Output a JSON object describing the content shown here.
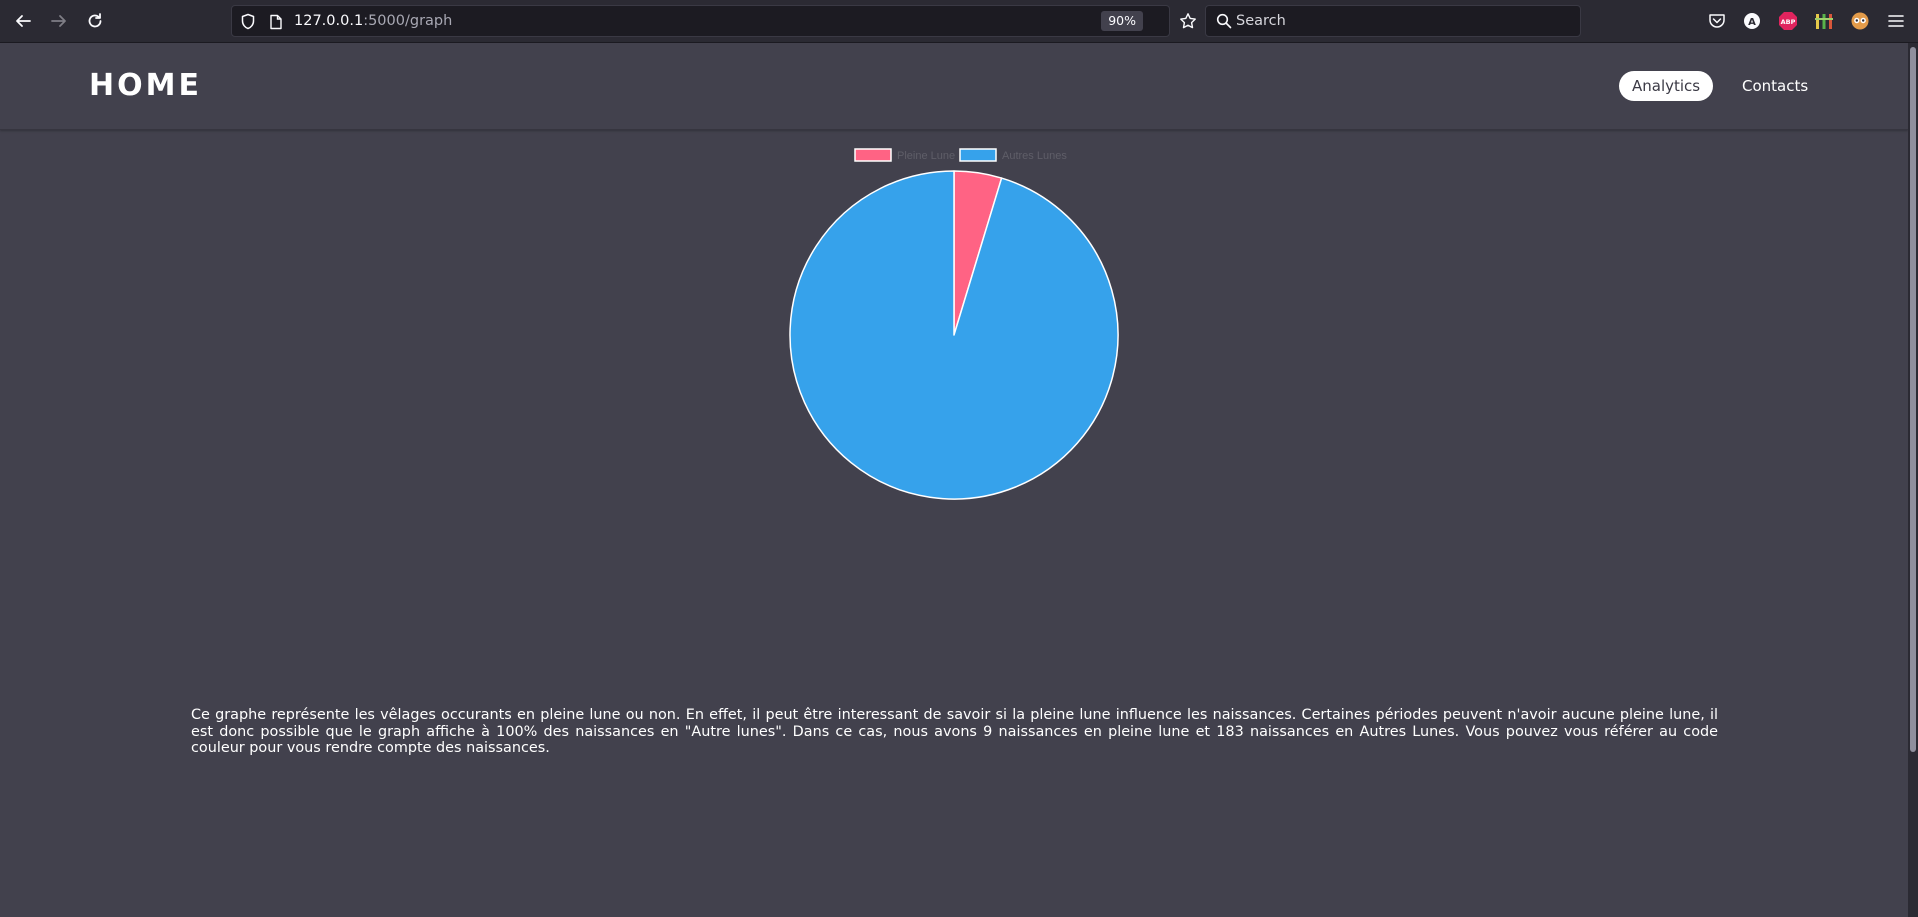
{
  "browser": {
    "url_host": "127.0.0.1",
    "url_path": ":5000/graph",
    "zoom": "90%",
    "search_placeholder": "Search",
    "icons": [
      "back-icon",
      "forward-icon",
      "reload-icon",
      "shield-icon",
      "page-icon",
      "star-icon",
      "search-icon",
      "pocket-icon",
      "account-icon",
      "adblock-icon",
      "extension-bars-icon",
      "extension-face-icon",
      "menu-icon"
    ]
  },
  "header": {
    "brand": "HOME",
    "nav": {
      "analytics": "Analytics",
      "contacts": "Contacts"
    }
  },
  "chart_data": {
    "type": "pie",
    "labels": [
      "Pleine Lune",
      "Autres Lunes"
    ],
    "values": [
      9,
      183
    ],
    "colors": [
      "#ff6384",
      "#36a2eb"
    ],
    "legend_position": "top"
  },
  "main": {
    "description": "Ce graphe représente les vêlages occurants en pleine lune ou non. En effet, il peut être interessant de savoir si la pleine lune influence les naissances. Certaines périodes peuvent n'avoir aucune pleine lune, il est donc possible que le graph affiche à 100% des naissances en \"Autre lunes\". Dans ce cas, nous avons 9 naissances en pleine lune et 183 naissances en Autres Lunes. Vous pouvez vous référer au code couleur pour vous rendre compte des naissances."
  }
}
